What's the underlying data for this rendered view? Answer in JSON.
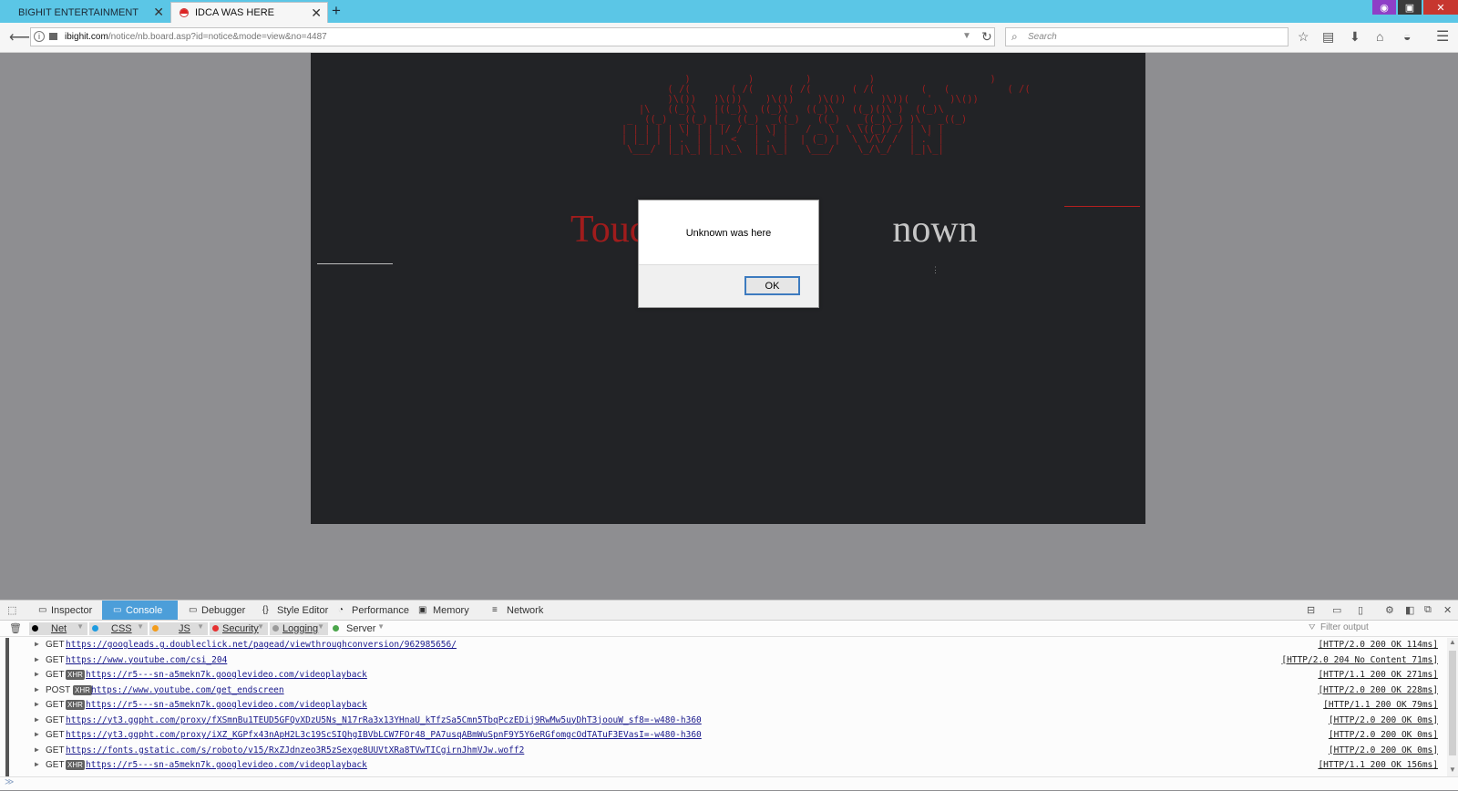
{
  "browser": {
    "tabs": [
      {
        "label": "BIGHIT ENTERTAINMENT",
        "active": false
      },
      {
        "label": "IDCA WAS HERE",
        "active": true
      }
    ],
    "new_tab": "+",
    "url_domain": "ibighit.com",
    "url_path": "/notice/nb.board.asp?id=notice&mode=view&no=4487",
    "search_placeholder": "Search"
  },
  "page": {
    "headline_left": "Touc",
    "headline_right": "nown",
    "ascii_art": "                       )          )         )          )                    )\n                    ( /(       ( /(      ( /(       ( /(        (   (          ( /(\n                    )\\())   )\\())    )\\())    )\\())      )\\))(   '   )\\())\n               |\\   ((_)\\   |((_)\\  ((_)\\   ((_)\\   ((_)()\\ )  ((_)\\\n             _  ((_)  _((_) |_  ((_)  _((_)   ((_)   _((_)\\_) )\\   _((_)\n            | | | | | \\| | | |/ /  | \\| |   / _ \\  \\ \\((_)/ / | \\| |\n            | |_| | | .` | |   <   | .` |  | (_) |  \\ \\/\\/ /  | .` |\n             \\___/  |_|\\_| |_|\\_\\  |_|\\_|   \\___/    \\_/\\_/   |_|\\_|"
  },
  "dialog": {
    "message": "Unknown was here",
    "ok_label": "OK"
  },
  "devtools": {
    "tabs": [
      "Inspector",
      "Console",
      "Debugger",
      "Style Editor",
      "Performance",
      "Memory",
      "Network"
    ],
    "selected_tab": "Console",
    "filters": [
      "Net",
      "CSS",
      "JS",
      "Security",
      "Logging",
      "Server"
    ],
    "filter_placeholder": "Filter output",
    "xhr_badge": "XHR",
    "rows": [
      {
        "method": "GET",
        "xhr": false,
        "url": "https://googleads.g.doubleclick.net/pagead/viewthroughconversion/962985656/",
        "status": "[HTTP/2.0 200 OK 114ms]"
      },
      {
        "method": "GET",
        "xhr": false,
        "url": "https://www.youtube.com/csi_204",
        "status": "[HTTP/2.0 204 No Content 71ms]"
      },
      {
        "method": "GET",
        "xhr": true,
        "url": "https://r5---sn-a5mekn7k.googlevideo.com/videoplayback",
        "status": "[HTTP/1.1 200 OK 271ms]"
      },
      {
        "method": "POST",
        "xhr": true,
        "url": "https://www.youtube.com/get_endscreen",
        "status": "[HTTP/2.0 200 OK 228ms]"
      },
      {
        "method": "GET",
        "xhr": true,
        "url": "https://r5---sn-a5mekn7k.googlevideo.com/videoplayback",
        "status": "[HTTP/1.1 200 OK 79ms]"
      },
      {
        "method": "GET",
        "xhr": false,
        "url": "https://yt3.ggpht.com/proxy/fXSmnBu1TEUD5GFQvXDzU5Ns_N17rRa3x13YHnaU_kTfzSa5Cmn5TbqPczEDij9RwMw5uyDhT3joouW_sf8=-w480-h360",
        "status": "[HTTP/2.0 200 OK 0ms]"
      },
      {
        "method": "GET",
        "xhr": false,
        "url": "https://yt3.ggpht.com/proxy/iXZ_KGPfx43nApH2L3c19ScSIQhgIBVbLCW7FOr48_PA7usqABmWuSpnF9Y5Y6eRGfomgcOdTATuF3EVasI=-w480-h360",
        "status": "[HTTP/2.0 200 OK 0ms]"
      },
      {
        "method": "GET",
        "xhr": false,
        "url": "https://fonts.gstatic.com/s/roboto/v15/RxZJdnzeo3R5zSexge8UUVtXRa8TVwTICgirnJhmVJw.woff2",
        "status": "[HTTP/2.0 200 OK 0ms]"
      },
      {
        "method": "GET",
        "xhr": true,
        "url": "https://r5---sn-a5mekn7k.googlevideo.com/videoplayback",
        "status": "[HTTP/1.1 200 OK 156ms]"
      }
    ]
  },
  "colors": {
    "tabstrip": "#5bc6e6",
    "devtools_selected": "#4c9ed9",
    "page_bg": "#222326",
    "ascii_red": "#9a1f1f"
  }
}
